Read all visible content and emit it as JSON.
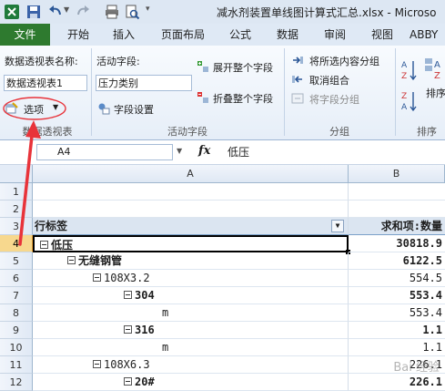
{
  "window": {
    "title": "减水剂装置单线图计算式汇总.xlsx - Microso"
  },
  "ribbon_tabs": [
    {
      "label": "文件"
    },
    {
      "label": "开始"
    },
    {
      "label": "插入"
    },
    {
      "label": "页面布局"
    },
    {
      "label": "公式"
    },
    {
      "label": "数据"
    },
    {
      "label": "审阅"
    },
    {
      "label": "视图"
    },
    {
      "label": "ABBY"
    }
  ],
  "ribbon": {
    "pivot_name_label": "数据透视表名称:",
    "pivot_name_value": "数据透视表1",
    "options_button": "选项",
    "group_pivot": "数据透视表",
    "active_field_label": "活动字段:",
    "active_field_value": "压力类别",
    "field_settings": "字段设置",
    "expand_field": "展开整个字段",
    "collapse_field": "折叠整个字段",
    "group_active_field": "活动字段",
    "group_selection": "将所选内容分组",
    "ungroup": "取消组合",
    "group_field": "将字段分组",
    "group_group": "分组",
    "sort_label": "排序",
    "group_sort": "排序"
  },
  "formula_bar": {
    "cell_ref": "A4",
    "fx": "fx",
    "value": "低压"
  },
  "sheet": {
    "columns": [
      "A",
      "B"
    ],
    "rows": [
      {
        "num": "1",
        "a": "",
        "b": ""
      },
      {
        "num": "2",
        "a": "",
        "b": ""
      },
      {
        "num": "3",
        "a": "行标签",
        "b": "求和项:数量"
      },
      {
        "num": "4",
        "a": "低压",
        "b": "30818.9"
      },
      {
        "num": "5",
        "a": "无缝钢管",
        "b": "6122.5"
      },
      {
        "num": "6",
        "a": "108X3.2",
        "b": "554.5"
      },
      {
        "num": "7",
        "a": "304",
        "b": "553.4"
      },
      {
        "num": "8",
        "a": "m",
        "b": "553.4"
      },
      {
        "num": "9",
        "a": "316",
        "b": "1.1"
      },
      {
        "num": "10",
        "a": "m",
        "b": "1.1"
      },
      {
        "num": "11",
        "a": "108X6.3",
        "b": "226.1"
      },
      {
        "num": "12",
        "a": "20#",
        "b": "226.1"
      }
    ]
  },
  "watermark": "Bai 经验",
  "colors": {
    "file_tab": "#2e7a2f",
    "selected_row_header": "#f7d88e",
    "annotation": "#e8333a"
  }
}
